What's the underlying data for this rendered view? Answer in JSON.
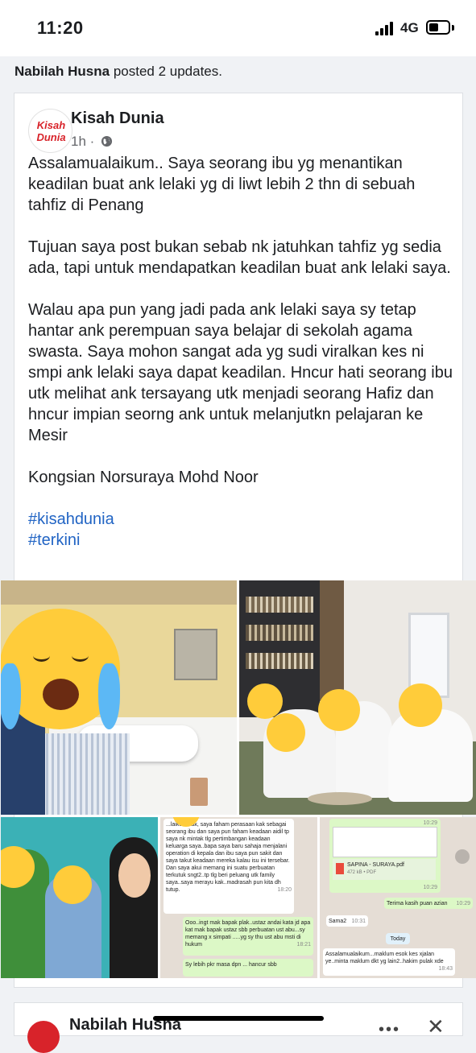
{
  "status_bar": {
    "time": "11:20",
    "network": "4G"
  },
  "activity": {
    "author": "Nabilah Husna",
    "action": "posted 2 updates."
  },
  "post": {
    "page_name": "Kisah Dunia",
    "logo_line1": "Kisah",
    "logo_line2": "Dunia",
    "time_ago": "1h",
    "separator": "·",
    "paragraphs": [
      "Assalamualaikum.. Saya seorang ibu  yg menantikan keadilan buat ank lelaki yg di liwt lebih 2 thn di sebuah tahfiz di Penang",
      "Tujuan saya post bukan sebab nk jatuhkan tahfiz yg sedia ada, tapi untuk mendapatkan keadilan buat ank lelaki saya.",
      "Walau apa pun yang jadi pada ank lelaki saya sy tetap hantar ank perempuan saya belajar di sekolah agama swasta. Saya mohon sangat ada yg sudi viralkan kes ni smpi ank lelaki saya dapat keadilan. Hncur hati seorang ibu utk melihat ank tersayang utk menjadi seorang Hafiz dan hncur impian seorng ank untuk melanjutkn pelajaran ke Mesir",
      "Kongsian Norsuraya Mohd Noor"
    ],
    "hashtags": [
      "#kisahdunia",
      "#terkini"
    ]
  },
  "chat_left": {
    "msg1": "...laikum kak, saya faham perasaan kak sebagai seorang ibu dan saya pun faham keadaan aidil tp saya nk mintak tlg pertimbangan keadaan keluarga saya..bapa saya baru sahaja menjalani operation di kepala dan ibu saya pun sakit dan saya takut keadaan mereka kalau isu ini tersebar. Dan saya akui memang ini suatu perbuatan terkutuk sngt2..tp tlg beri peluang utk family saya..saya merayu kak..madrasah pun kita dh tutup.",
    "msg1_time": "18:20",
    "msg2": "Ooo..ingt mak bapak plak..ustaz andai kata jd apa kat mak bapak ustaz sbb perbuatan ust abu...sy memang x simpati .....yg sy thu ust abu msti di hukum",
    "msg2_time": "18:21",
    "msg3": "Sy lebih pkr masa dpn ... hancur sbb"
  },
  "chat_right": {
    "top_time": "10:29",
    "file_name": "SAPINA - SURAYA.pdf",
    "file_meta": "472 kB • PDF",
    "file_time": "10:29",
    "msg_thanks": "Terima kasih puan azian",
    "msg_thanks_time": "10:29",
    "msg_sama": "Sama2",
    "msg_sama_time": "10:31",
    "day_label": "Today",
    "msg_last": "Assalamualaikum...maklum esok kes xjalan ye..minta maklum dkt yg lain2..hakim pulak xde",
    "msg_last_time": "18:43"
  },
  "next_post": {
    "author": "Nabilah Husna"
  },
  "icons": [
    "signal-icon",
    "battery-icon",
    "globe-icon",
    "more-icon",
    "close-icon"
  ],
  "colors": {
    "hashtag": "#2164c4",
    "brand": "#d8232a",
    "whatsapp_bg": "#e5ddd5",
    "whatsapp_out": "#dcf8c6"
  }
}
